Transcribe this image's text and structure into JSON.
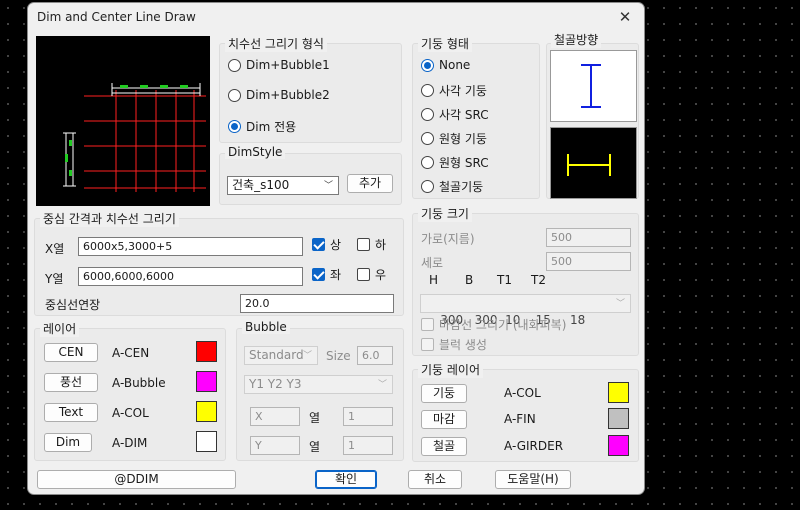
{
  "window": {
    "title": "Dim and Center Line Draw",
    "close_glyph": "✕"
  },
  "dim_style_group": {
    "title": "치수선 그리기 형식",
    "options": [
      "Dim+Bubble1",
      "Dim+Bubble2",
      "Dim 전용"
    ],
    "selected": "Dim 전용"
  },
  "dimstyle": {
    "title": "DimStyle",
    "value": "건축_s100",
    "add_label": "추가"
  },
  "column_type": {
    "title": "기둥 형태",
    "options": [
      "None",
      "사각 기둥",
      "사각 SRC",
      "원형 기둥",
      "원형 SRC",
      "철골기둥"
    ],
    "selected": "None"
  },
  "steel_direction": {
    "title": "철골방향"
  },
  "center_spacing": {
    "title": "중심 간격과 치수선 그리기",
    "x_label": "X열",
    "x_value": "6000x5,3000+5",
    "y_label": "Y열",
    "y_value": "6000,6000,6000",
    "x_check1": "상",
    "x_check2": "하",
    "y_check1": "좌",
    "y_check2": "우",
    "ext_label": "중심선연장",
    "ext_value": "20.0"
  },
  "column_size": {
    "title": "기둥 크기",
    "width_label": "가로(지름)",
    "width_value": "500",
    "height_label": "세로",
    "height_value": "500",
    "headers": [
      "H",
      "B",
      "T1",
      "T2"
    ],
    "profile": "300   300  10    15     18",
    "finish_check": "마감선 그리기 (내화피복)",
    "block_check": "블럭 생성"
  },
  "layer": {
    "title": "레이어",
    "rows": [
      {
        "button": "CEN",
        "name": "A-CEN",
        "color": "#ff0000"
      },
      {
        "button": "풍선",
        "name": "A-Bubble",
        "color": "#ff00ff"
      },
      {
        "button": "Text",
        "name": "A-COL",
        "color": "#ffff00"
      },
      {
        "button": "Dim",
        "name": "A-DIM",
        "color": "#ffffff"
      }
    ]
  },
  "bubble": {
    "title": "Bubble",
    "style": "Standard",
    "size_label": "Size",
    "size_value": "6.0",
    "labels": "Y1 Y2 Y3",
    "x_field": "X",
    "x_col": "열",
    "x_count": "1",
    "y_field": "Y",
    "y_col": "열",
    "y_count": "1"
  },
  "column_layer": {
    "title": "기둥 레이어",
    "rows": [
      {
        "button": "기둥",
        "name": "A-COL",
        "color": "#ffff00"
      },
      {
        "button": "마감",
        "name": "A-FIN",
        "color": "#c0c0c0"
      },
      {
        "button": "철골",
        "name": "A-GIRDER",
        "color": "#ff00ff"
      }
    ]
  },
  "footer": {
    "ddim": "@DDIM",
    "ok": "확인",
    "cancel": "취소",
    "help": "도움말(H)"
  }
}
